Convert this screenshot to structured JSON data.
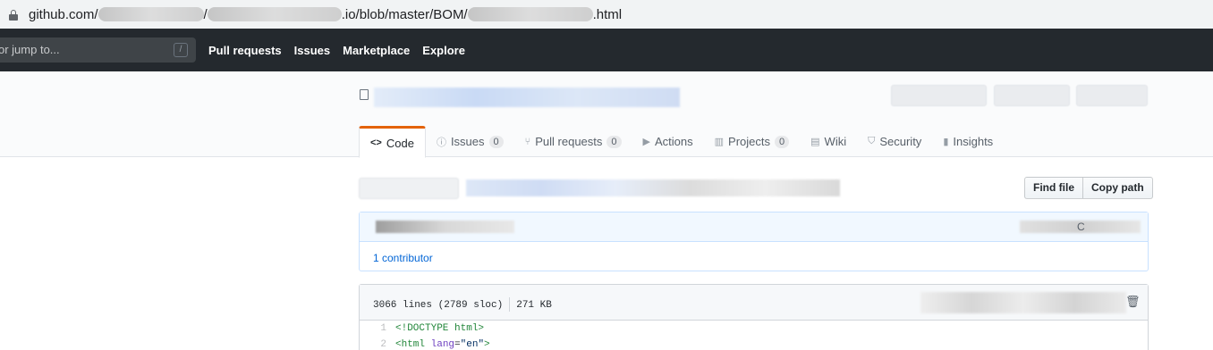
{
  "urlbar": {
    "prefix": "github.com/",
    "mid": ".io/blob/master/BOM/",
    "suffix": ".html"
  },
  "header": {
    "search_placeholder": "or jump to...",
    "slash_key": "/",
    "nav": [
      "Pull requests",
      "Issues",
      "Marketplace",
      "Explore"
    ]
  },
  "tabs": [
    {
      "icon": "<>",
      "label": "Code",
      "count": null,
      "selected": true
    },
    {
      "icon": "ⓘ",
      "label": "Issues",
      "count": "0"
    },
    {
      "icon": "⑂",
      "label": "Pull requests",
      "count": "0"
    },
    {
      "icon": "▶",
      "label": "Actions",
      "count": null
    },
    {
      "icon": "▥",
      "label": "Projects",
      "count": "0"
    },
    {
      "icon": "▤",
      "label": "Wiki",
      "count": null
    },
    {
      "icon": "⛉",
      "label": "Security",
      "count": null
    },
    {
      "icon": "▮",
      "label": "Insights",
      "count": null
    }
  ],
  "file_actions": {
    "find_file": "Find file",
    "copy_path": "Copy path"
  },
  "commit": {
    "partial_char": "C",
    "contributors": "1 contributor"
  },
  "file": {
    "lines": "3066 lines (2789 sloc)",
    "size": "271 KB",
    "trash_icon": "🗑",
    "code": [
      {
        "num": "1",
        "tag": "<!DOCTYPE html>"
      },
      {
        "num": "2",
        "open": "<html",
        "attr": "lang",
        "eq": "=",
        "val": "\"en\"",
        "close": ">"
      }
    ]
  }
}
